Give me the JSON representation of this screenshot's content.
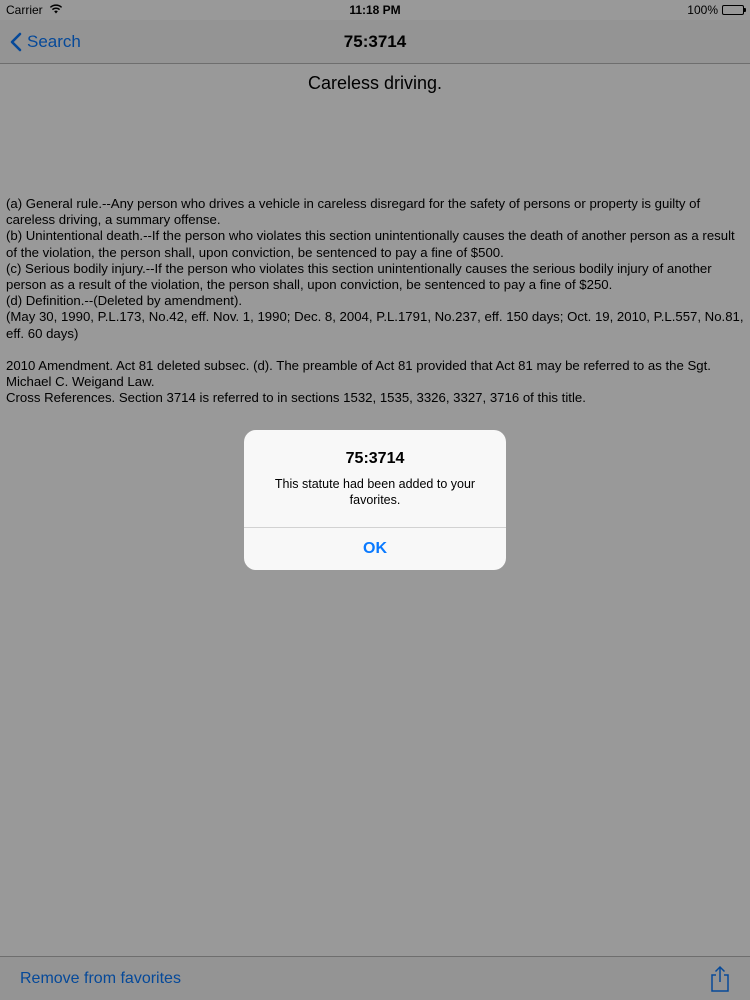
{
  "status_bar": {
    "carrier": "Carrier",
    "time": "11:18 PM",
    "battery": "100%"
  },
  "nav": {
    "back_label": "Search",
    "title": "75:3714"
  },
  "document": {
    "title": "Careless driving.",
    "paragraphs": [
      "(a)  General rule.--Any person who drives a vehicle in careless disregard for the safety of persons or property is guilty of careless driving, a summary offense.",
      "(b)  Unintentional death.--If the person who violates this section unintentionally causes the death of another person as a result of the violation, the person shall, upon conviction, be sentenced to pay a fine of $500.",
      "(c)  Serious bodily injury.--If the person who violates this section unintentionally causes the serious bodily injury of another person as a result of the violation, the person shall, upon conviction, be sentenced to pay a fine of $250.",
      "(d)  Definition.--(Deleted by amendment).",
      "(May 30, 1990, P.L.173, No.42, eff. Nov. 1, 1990; Dec. 8, 2004, P.L.1791, No.237, eff. 150 days; Oct. 19, 2010, P.L.557, No.81, eff. 60 days)",
      "2010 Amendment.  Act 81 deleted subsec. (d). The preamble of Act 81 provided that Act 81 may be referred to as the Sgt. Michael C. Weigand Law.",
      "Cross References.  Section 3714 is referred to in sections 1532, 1535, 3326, 3327, 3716 of this title."
    ]
  },
  "toolbar": {
    "remove_label": "Remove from favorites"
  },
  "alert": {
    "title": "75:3714",
    "message": "This statute had been added to your favorites.",
    "ok_label": "OK"
  },
  "colors": {
    "accent": "#0a7aff",
    "overlay": "rgba(0,0,0,0.40)"
  }
}
